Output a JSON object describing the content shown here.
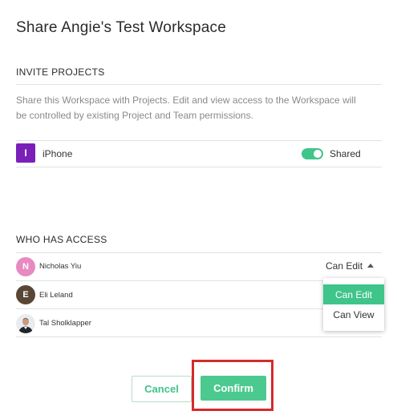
{
  "dialog": {
    "title": "Share Angie's Test Workspace"
  },
  "invite_projects": {
    "header": "INVITE PROJECTS",
    "description": "Share this Workspace with Projects. Edit and view access to the Workspace will be controlled by existing Project and Team permissions.",
    "projects": [
      {
        "initial": "I",
        "name": "iPhone",
        "badge_color": "#7a1fb8",
        "shared": true,
        "toggle_label": "Shared"
      }
    ]
  },
  "who_has_access": {
    "header": "WHO HAS ACCESS",
    "users": [
      {
        "initial": "N",
        "name": "Nicholas Yiu",
        "avatar_color": "#e78ac1",
        "permission": "Can Edit"
      },
      {
        "initial": "E",
        "name": "Eli Leland",
        "avatar_color": "#5a4636"
      },
      {
        "name": "Tal Sholklapper",
        "avatar": "photo"
      }
    ]
  },
  "permission_dropdown": {
    "options": [
      "Can Edit",
      "Can View"
    ],
    "selected": "Can Edit"
  },
  "buttons": {
    "cancel": "Cancel",
    "confirm": "Confirm"
  },
  "colors": {
    "accent": "#3fc48a",
    "highlight": "#d32b2b"
  }
}
